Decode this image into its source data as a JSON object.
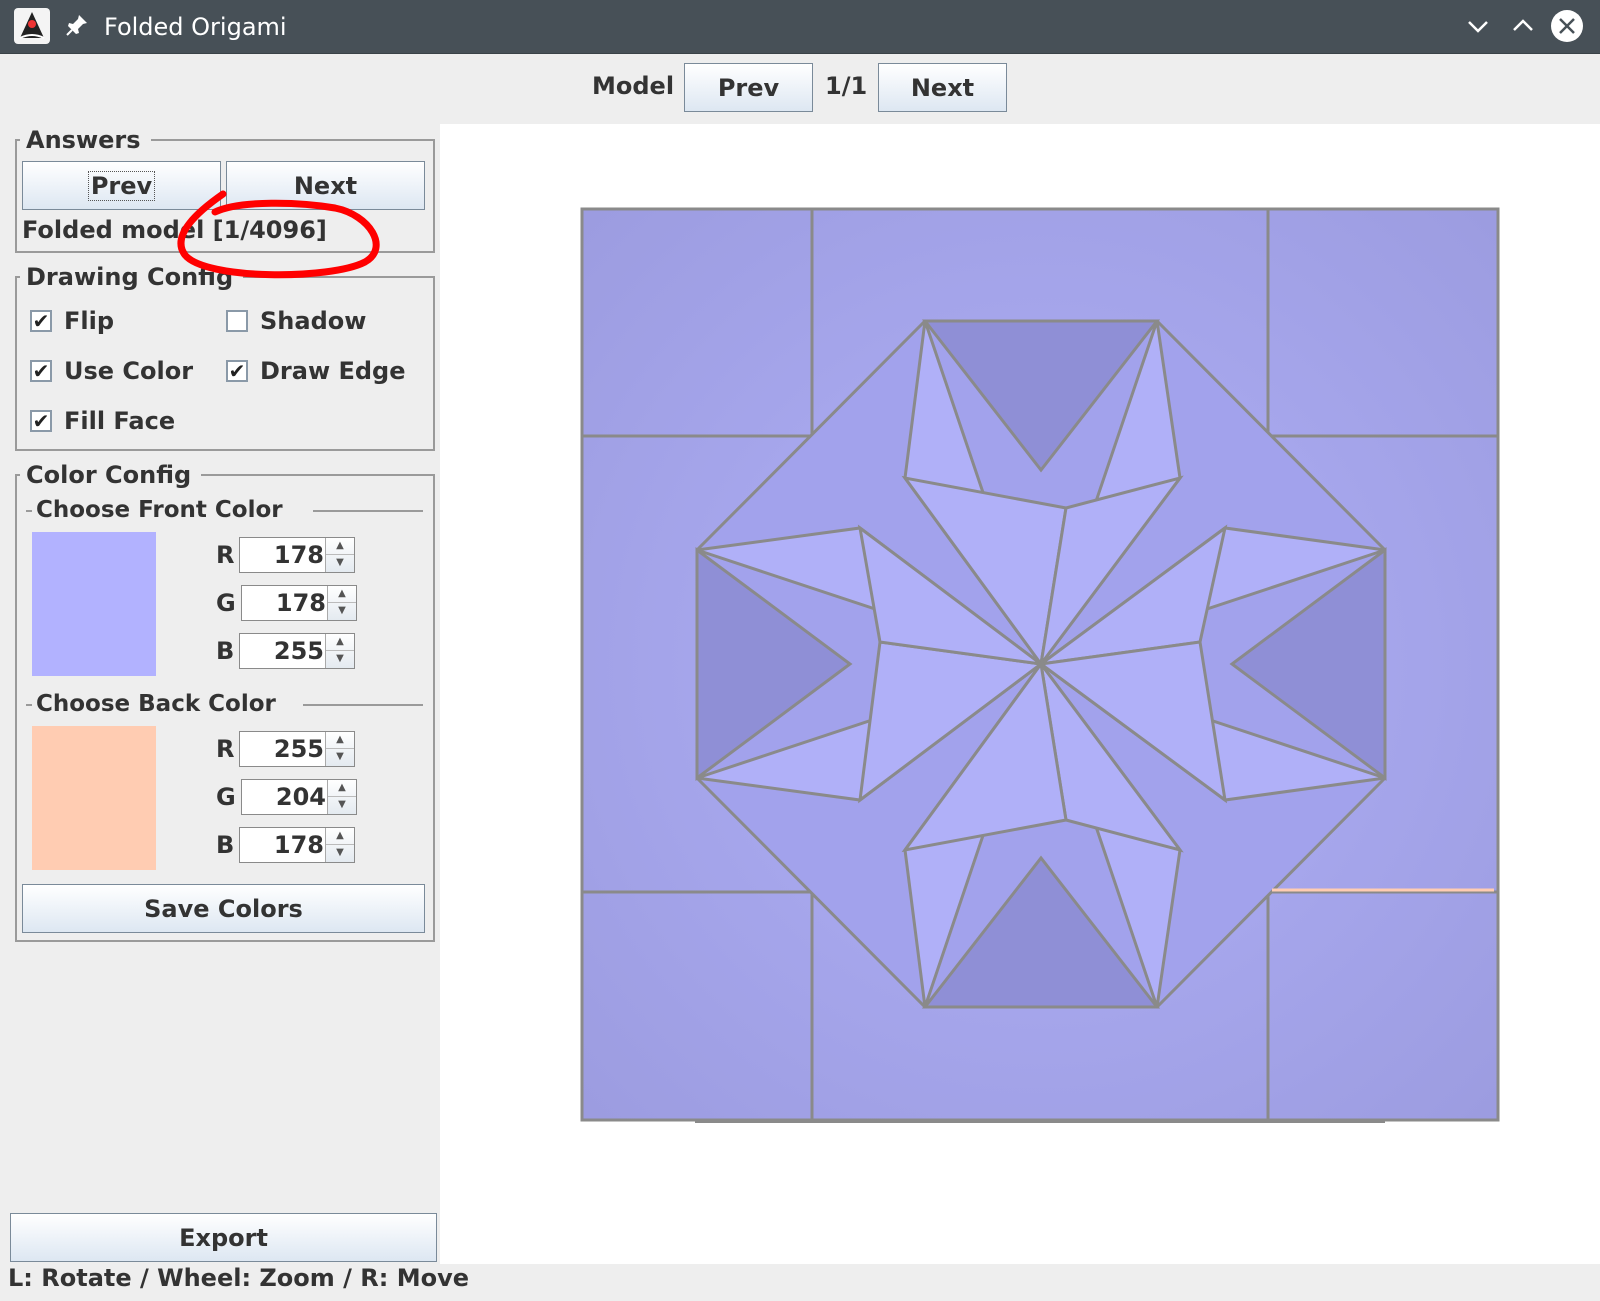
{
  "window": {
    "title": "Folded Origami"
  },
  "model_nav": {
    "label": "Model",
    "prev": "Prev",
    "counter": "1/1",
    "next": "Next"
  },
  "answers": {
    "title": "Answers",
    "prev": "Prev",
    "next": "Next",
    "status": "Folded model [1/4096]"
  },
  "drawing_config": {
    "title": "Drawing Config",
    "flip": {
      "label": "Flip",
      "checked": true
    },
    "shadow": {
      "label": "Shadow",
      "checked": false
    },
    "use_color": {
      "label": "Use Color",
      "checked": true
    },
    "draw_edge": {
      "label": "Draw Edge",
      "checked": true
    },
    "fill_face": {
      "label": "Fill Face",
      "checked": true
    }
  },
  "color_config": {
    "title": "Color Config",
    "front": {
      "title": "Choose Front Color",
      "r_label": "R",
      "g_label": "G",
      "b_label": "B",
      "r": "178",
      "g": "178",
      "b": "255",
      "hex": "#b2b2ff"
    },
    "back": {
      "title": "Choose Back Color",
      "r_label": "R",
      "g_label": "G",
      "b_label": "B",
      "r": "255",
      "g": "204",
      "b": "178",
      "hex": "#ffccb2"
    },
    "save": "Save Colors"
  },
  "export": "Export",
  "status_bar": "L: Rotate / Wheel: Zoom / R: Move",
  "colors": {
    "titlebar": "#475057",
    "model_fill": "#a8a8ef",
    "model_edge": "#8a8a8a",
    "annotation": "#ff0000"
  }
}
